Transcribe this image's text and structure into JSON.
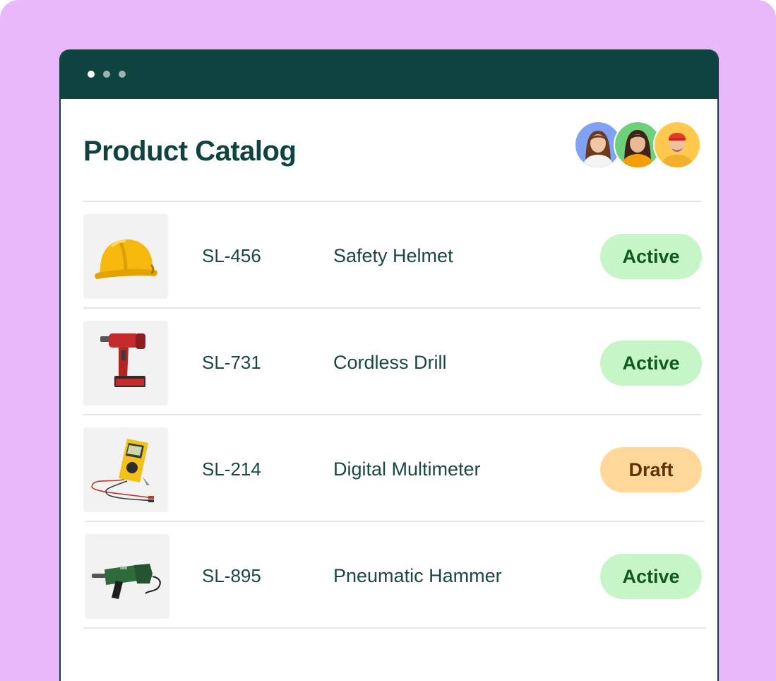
{
  "page": {
    "title": "Product Catalog",
    "background_color": "#e8b8fb",
    "titlebar_color": "#0e4340"
  },
  "collaborators": [
    {
      "icon": "avatar-woman-long-hair",
      "color": "#7fa2f4"
    },
    {
      "icon": "avatar-woman-dark-hair",
      "color": "#6fd07a"
    },
    {
      "icon": "avatar-man-beanie",
      "color": "#ffc94d"
    }
  ],
  "products": [
    {
      "sku": "SL-456",
      "name": "Safety Helmet",
      "status": "Active",
      "icon": "helmet-image"
    },
    {
      "sku": "SL-731",
      "name": "Cordless Drill",
      "status": "Active",
      "icon": "drill-image"
    },
    {
      "sku": "SL-214",
      "name": "Digital Multimeter",
      "status": "Draft",
      "icon": "multimeter-image"
    },
    {
      "sku": "SL-895",
      "name": "Pneumatic Hammer",
      "status": "Active",
      "icon": "hammer-drill-image"
    }
  ],
  "status_colors": {
    "Active": {
      "bg": "#c6f5c8",
      "fg": "#0f5a1c"
    },
    "Draft": {
      "bg": "#ffd799",
      "fg": "#5a3306"
    }
  }
}
